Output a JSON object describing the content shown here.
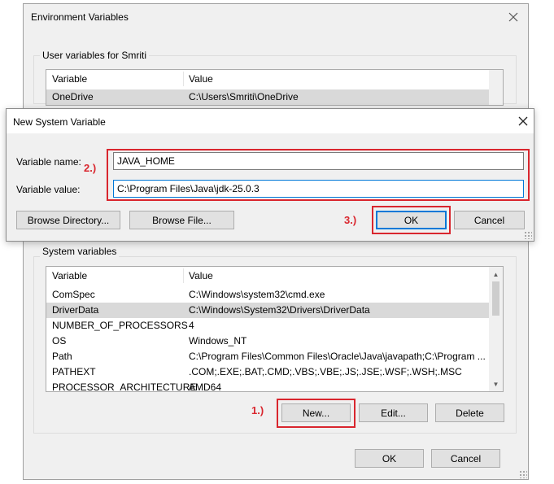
{
  "env_window": {
    "title": "Environment Variables",
    "user_group_label": "User variables for Smriti",
    "user_columns": [
      "Variable",
      "Value"
    ],
    "user_rows": [
      {
        "variable": "OneDrive",
        "value": "C:\\Users\\Smriti\\OneDrive"
      }
    ],
    "system_group_label": "System variables",
    "system_columns": [
      "Variable",
      "Value"
    ],
    "system_rows": [
      {
        "variable": "ComSpec",
        "value": "C:\\Windows\\system32\\cmd.exe"
      },
      {
        "variable": "DriverData",
        "value": "C:\\Windows\\System32\\Drivers\\DriverData"
      },
      {
        "variable": "NUMBER_OF_PROCESSORS",
        "value": "4"
      },
      {
        "variable": "OS",
        "value": "Windows_NT"
      },
      {
        "variable": "Path",
        "value": "C:\\Program Files\\Common Files\\Oracle\\Java\\javapath;C:\\Program ..."
      },
      {
        "variable": "PATHEXT",
        "value": ".COM;.EXE;.BAT;.CMD;.VBS;.VBE;.JS;.JSE;.WSF;.WSH;.MSC"
      },
      {
        "variable": "PROCESSOR_ARCHITECTURE",
        "value": "AMD64"
      }
    ],
    "new_label": "New...",
    "edit_label": "Edit...",
    "delete_label": "Delete",
    "ok_label": "OK",
    "cancel_label": "Cancel"
  },
  "dialog": {
    "title": "New System Variable",
    "name_label": "Variable name:",
    "name_value": "JAVA_HOME",
    "value_label": "Variable value:",
    "value_value": "C:\\Program Files\\Java\\jdk-25.0.3",
    "browse_directory_label": "Browse Directory...",
    "browse_file_label": "Browse File...",
    "ok_label": "OK",
    "cancel_label": "Cancel"
  },
  "annotations": {
    "step1": "1.)",
    "step2": "2.)",
    "step3": "3.)",
    "color": "#d9262e"
  },
  "icons": {
    "close": "close-icon",
    "scroll_up": "scroll-up-arrow-icon",
    "scroll_down": "scroll-down-arrow-icon"
  }
}
